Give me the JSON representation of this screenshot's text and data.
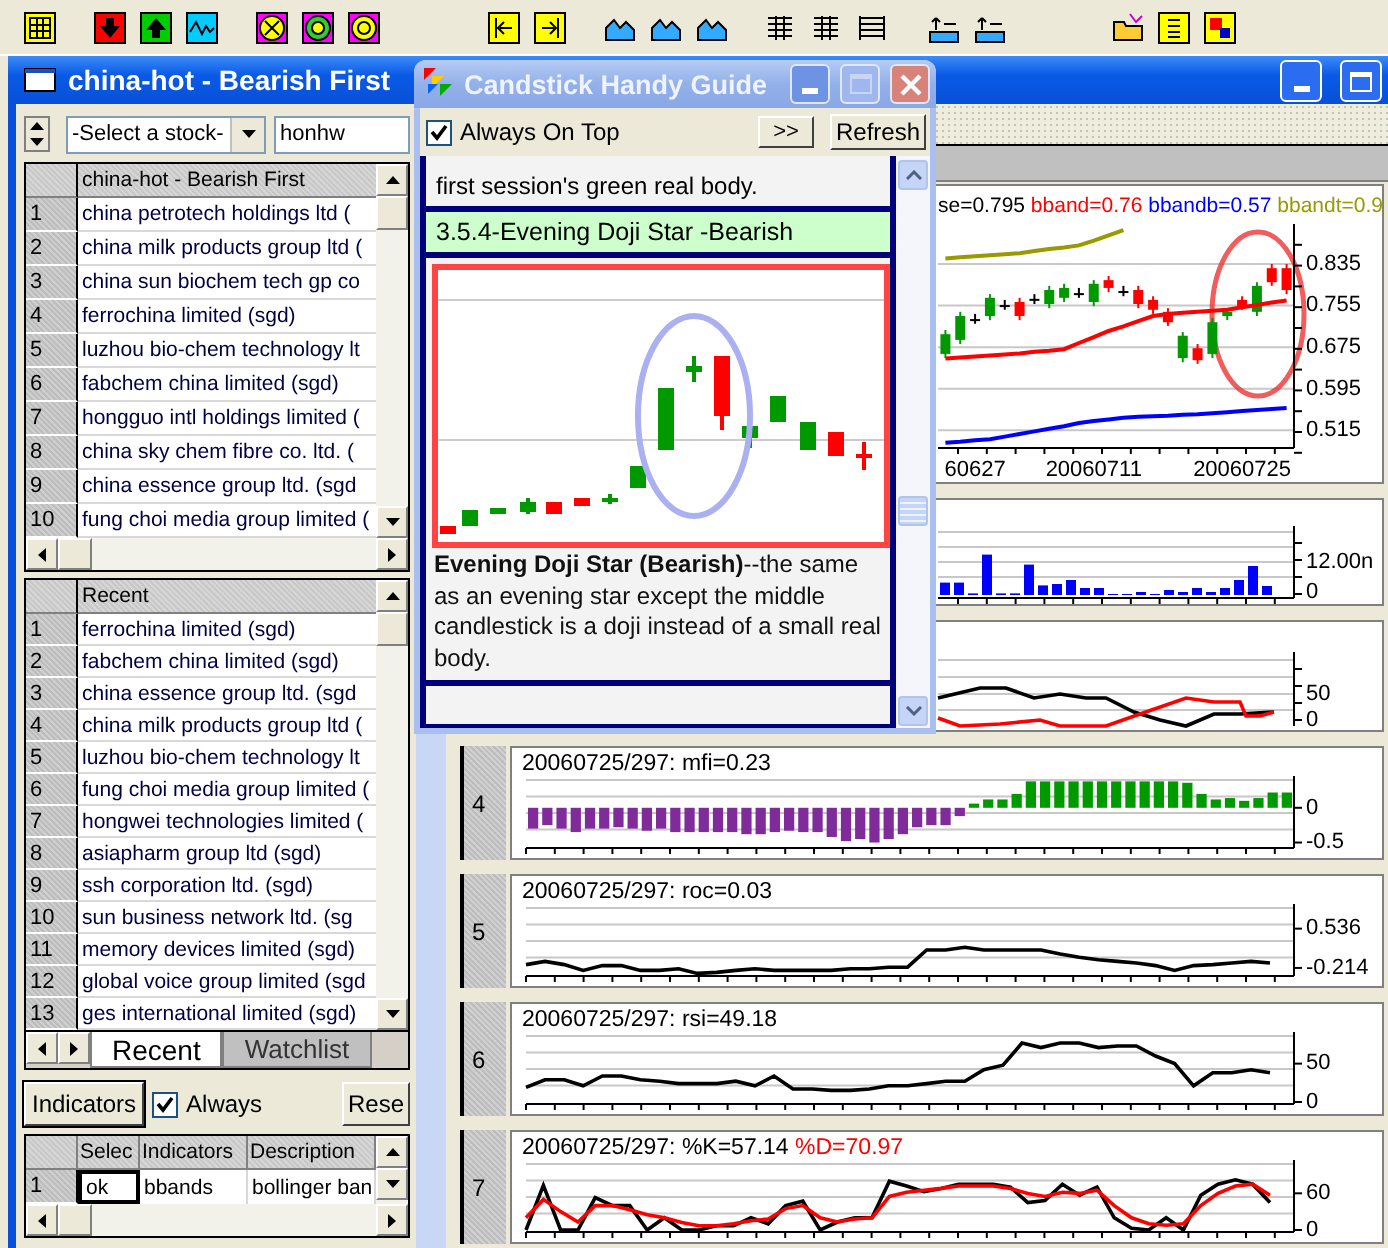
{
  "window": {
    "title": "china-hot - Bearish First"
  },
  "stock_picker": {
    "selection": "-Select a stock-",
    "search_value": "honhw"
  },
  "hot_list": {
    "header": "china-hot - Bearish First",
    "rows": [
      {
        "number": "1",
        "name": "china petrotech holdings ltd ("
      },
      {
        "number": "2",
        "name": "china milk products group ltd ("
      },
      {
        "number": "3",
        "name": "china sun biochem tech gp co"
      },
      {
        "number": "4",
        "name": "ferrochina limited (sgd)"
      },
      {
        "number": "5",
        "name": "luzhou bio-chem technology lt"
      },
      {
        "number": "6",
        "name": "fabchem china limited (sgd)"
      },
      {
        "number": "7",
        "name": "hongguo intl holdings limited ("
      },
      {
        "number": "8",
        "name": "china sky chem fibre co. ltd. ("
      },
      {
        "number": "9",
        "name": "china essence group ltd. (sgd"
      },
      {
        "number": "10",
        "name": "fung choi media group limited ("
      }
    ]
  },
  "recent_list": {
    "header": "Recent",
    "rows": [
      {
        "number": "1",
        "name": "ferrochina limited (sgd)"
      },
      {
        "number": "2",
        "name": "fabchem china limited (sgd)"
      },
      {
        "number": "3",
        "name": "china essence group ltd. (sgd"
      },
      {
        "number": "4",
        "name": "china milk products group ltd ("
      },
      {
        "number": "5",
        "name": "luzhou bio-chem technology lt"
      },
      {
        "number": "6",
        "name": "fung choi media group limited ("
      },
      {
        "number": "7",
        "name": "hongwei technologies limited ("
      },
      {
        "number": "8",
        "name": "asiapharm group ltd (sgd)"
      },
      {
        "number": "9",
        "name": "ssh corporation ltd. (sgd)"
      },
      {
        "number": "10",
        "name": "sun business network ltd. (sg"
      },
      {
        "number": "11",
        "name": "memory devices limited (sgd)"
      },
      {
        "number": "12",
        "name": "global voice group limited (sgd"
      },
      {
        "number": "13",
        "name": "ges international limited (sgd)"
      }
    ]
  },
  "list_tabs": [
    {
      "label": "Recent",
      "selected": true
    },
    {
      "label": "Watchlist",
      "selected": false
    }
  ],
  "indicator_bar": {
    "button": "Indicators",
    "always": {
      "label": "Always",
      "checked": true
    },
    "reset_button": "Rese"
  },
  "indicator_table": {
    "columns": [
      "Selec",
      "Indicators",
      "Description"
    ],
    "rows": [
      {
        "number": "1",
        "cells": [
          {
            "text": "ok",
            "selected": true
          },
          {
            "text": "bbands",
            "selected": false
          },
          {
            "text": "bollinger ban",
            "selected": false
          }
        ]
      }
    ]
  },
  "price_chart": {
    "legend": [
      {
        "text": "se=0.795",
        "color": "#000000"
      },
      {
        "text": "bband=0.76",
        "color": "#ff0000"
      },
      {
        "text": "bbandb=0.57",
        "color": "#0000ff"
      },
      {
        "text": "bbandt=0.9",
        "color": "#999900"
      }
    ],
    "chart_data": {
      "type": "candlestick",
      "categories": [
        null,
        null,
        "60627",
        null,
        null,
        null,
        null,
        null,
        null,
        null,
        "20060711",
        null,
        null,
        null,
        null,
        null,
        null,
        null,
        null,
        null,
        "20060725",
        null,
        null,
        null
      ],
      "ohlc": [
        [
          0.662,
          0.708,
          0.654,
          0.7
        ],
        [
          0.689,
          0.743,
          0.681,
          0.735
        ],
        [
          0.729,
          0.739,
          0.72,
          0.729
        ],
        [
          0.735,
          0.777,
          0.727,
          0.77
        ],
        [
          0.756,
          0.766,
          0.747,
          0.756
        ],
        [
          0.762,
          0.77,
          0.727,
          0.735
        ],
        [
          0.768,
          0.777,
          0.758,
          0.768
        ],
        [
          0.758,
          0.793,
          0.75,
          0.785
        ],
        [
          0.77,
          0.797,
          0.762,
          0.789
        ],
        [
          0.779,
          0.789,
          0.77,
          0.779
        ],
        [
          0.762,
          0.804,
          0.754,
          0.797
        ],
        [
          0.804,
          0.812,
          0.781,
          0.789
        ],
        [
          0.783,
          0.793,
          0.773,
          0.783
        ],
        [
          0.785,
          0.793,
          0.75,
          0.758
        ],
        [
          0.766,
          0.773,
          0.739,
          0.747
        ],
        [
          0.743,
          0.75,
          0.716,
          0.723
        ],
        [
          0.654,
          0.704,
          0.646,
          0.697
        ],
        [
          0.673,
          0.681,
          0.643,
          0.65
        ],
        [
          0.662,
          0.731,
          0.654,
          0.723
        ],
        [
          0.735,
          0.75,
          0.727,
          0.743
        ],
        [
          0.766,
          0.773,
          0.747,
          0.754
        ],
        [
          0.743,
          0.8,
          0.735,
          0.793
        ],
        [
          0.827,
          0.835,
          0.793,
          0.8
        ],
        [
          0.827,
          0.835,
          0.777,
          0.785
        ]
      ],
      "grid": true,
      "ylim": [
        0.481,
        0.912
      ],
      "yticks": [
        {
          "value": 0.835,
          "label": "0.835"
        },
        {
          "value": 0.755,
          "label": "0.755"
        },
        {
          "value": 0.675,
          "label": "0.675"
        },
        {
          "value": 0.595,
          "label": "0.595"
        },
        {
          "value": 0.515,
          "label": "0.515"
        }
      ]
    }
  },
  "volume_chart": {
    "ticks": [
      "12.00n",
      "0"
    ]
  },
  "oscillator_chart": {
    "ticks": [
      "50",
      "0"
    ]
  },
  "indicator_panes": [
    {
      "number": "4",
      "title": [
        {
          "text": "20060725/297: mfi=0.23",
          "color": "#000000"
        }
      ],
      "chart_data": {
        "type": "bar",
        "stacked": true,
        "ylim": [
          -0.55,
          0.4
        ],
        "yticks": [
          0,
          -0.5
        ],
        "series": [
          {
            "color": "#7f2b9a",
            "values": [
              -0.3,
              -0.25,
              -0.3,
              -0.35,
              -0.3,
              -0.3,
              -0.28,
              -0.3,
              -0.33,
              -0.3,
              -0.35,
              -0.35,
              -0.35,
              -0.35,
              -0.35,
              -0.38,
              -0.38,
              -0.35,
              -0.33,
              -0.35,
              -0.35,
              -0.42,
              -0.48,
              -0.45,
              -0.5,
              -0.45,
              -0.38,
              -0.28,
              -0.25,
              -0.25,
              -0.12,
              null,
              null,
              null,
              null,
              null,
              null,
              null,
              null,
              null,
              null,
              null,
              null,
              null,
              null,
              null,
              null,
              null,
              null,
              null,
              null,
              null,
              null,
              null
            ]
          },
          {
            "color": "#009900",
            "values": [
              null,
              null,
              null,
              null,
              null,
              null,
              null,
              null,
              null,
              null,
              null,
              null,
              null,
              null,
              null,
              null,
              null,
              null,
              null,
              null,
              null,
              null,
              null,
              null,
              null,
              null,
              null,
              null,
              null,
              null,
              null,
              0.06,
              0.12,
              0.12,
              0.2,
              0.38,
              0.38,
              0.38,
              0.38,
              0.38,
              0.38,
              0.38,
              0.38,
              0.38,
              0.38,
              0.38,
              0.36,
              0.2,
              0.12,
              0.14,
              0.1,
              0.14,
              0.22,
              0.22
            ]
          }
        ]
      }
    },
    {
      "number": "5",
      "title": [
        {
          "text": "20060725/297: roc=0.03",
          "color": "#000000"
        }
      ],
      "chart_data": {
        "type": "line",
        "ylim": [
          -0.33,
          0.93
        ],
        "yticks": [
          {
            "value": 0.536,
            "label": "0.536"
          },
          {
            "value": -0.214,
            "label": "-0.214"
          }
        ],
        "series": [
          {
            "color": "#000000",
            "values": [
              -0.15,
              -0.09,
              -0.15,
              -0.26,
              -0.17,
              -0.17,
              -0.26,
              -0.26,
              -0.23,
              -0.32,
              -0.3,
              -0.26,
              -0.23,
              -0.26,
              -0.26,
              -0.26,
              -0.26,
              -0.23,
              -0.23,
              -0.2,
              -0.2,
              0.13,
              0.13,
              0.18,
              0.13,
              0.13,
              0.13,
              0.13,
              0.05,
              -0.01,
              -0.06,
              -0.09,
              -0.12,
              -0.17,
              -0.26,
              -0.17,
              -0.15,
              -0.12,
              -0.09,
              -0.12
            ]
          }
        ]
      }
    },
    {
      "number": "6",
      "title": [
        {
          "text": "20060725/297: rsi=49.18",
          "color": "#000000"
        }
      ],
      "chart_data": {
        "type": "line",
        "ylim": [
          0,
          86
        ],
        "yticks": [
          50,
          0
        ],
        "series": [
          {
            "color": "#000000",
            "values": [
              19,
              29,
              29,
              21,
              34,
              34,
              29,
              27,
              24,
              24,
              24,
              27,
              21,
              34,
              17,
              17,
              15,
              15,
              17,
              21,
              21,
              24,
              27,
              27,
              42,
              48,
              77,
              71,
              77,
              77,
              71,
              73,
              73,
              60,
              50,
              21,
              38,
              38,
              42,
              38
            ]
          }
        ]
      }
    },
    {
      "number": "7",
      "title": [
        {
          "text": "20060725/297: %K=57.14",
          "color": "#000000"
        },
        {
          "text": "%D=70.97",
          "color": "#ff0000"
        }
      ],
      "chart_data": {
        "type": "line",
        "ylim": [
          0,
          108
        ],
        "yticks": [
          60,
          0
        ],
        "series": [
          {
            "color": "#000000",
            "values": [
              0,
              73,
              0,
              0,
              53,
              40,
              40,
              0,
              20,
              0,
              0,
              7,
              7,
              20,
              10,
              40,
              47,
              0,
              13,
              20,
              20,
              80,
              72,
              63,
              68,
              75,
              75,
              75,
              70,
              45,
              48,
              75,
              57,
              70,
              20,
              3,
              0,
              20,
              0,
              57,
              75,
              82,
              75,
              45
            ]
          },
          {
            "color": "#ff0000",
            "values": [
              20,
              50,
              30,
              13,
              40,
              40,
              33,
              25,
              20,
              12,
              7,
              7,
              10,
              15,
              18,
              35,
              40,
              20,
              13,
              18,
              20,
              55,
              62,
              65,
              68,
              72,
              72,
              72,
              68,
              60,
              55,
              62,
              60,
              65,
              40,
              20,
              10,
              8,
              10,
              40,
              60,
              72,
              75,
              57
            ]
          }
        ]
      }
    }
  ],
  "guide": {
    "title": "Candstick Handy Guide",
    "always_on_top": {
      "label": "Always On Top",
      "checked": true
    },
    "buttons": [
      ">>",
      "Refresh"
    ],
    "previous_text": "first session's green real body.",
    "heading": "3.5.4-Evening Doji Star -Bearish",
    "description": "**Evening Doji Star (Bearish)**--the same as an evening star except the middle candlestick is a doji instead of a small real body."
  }
}
